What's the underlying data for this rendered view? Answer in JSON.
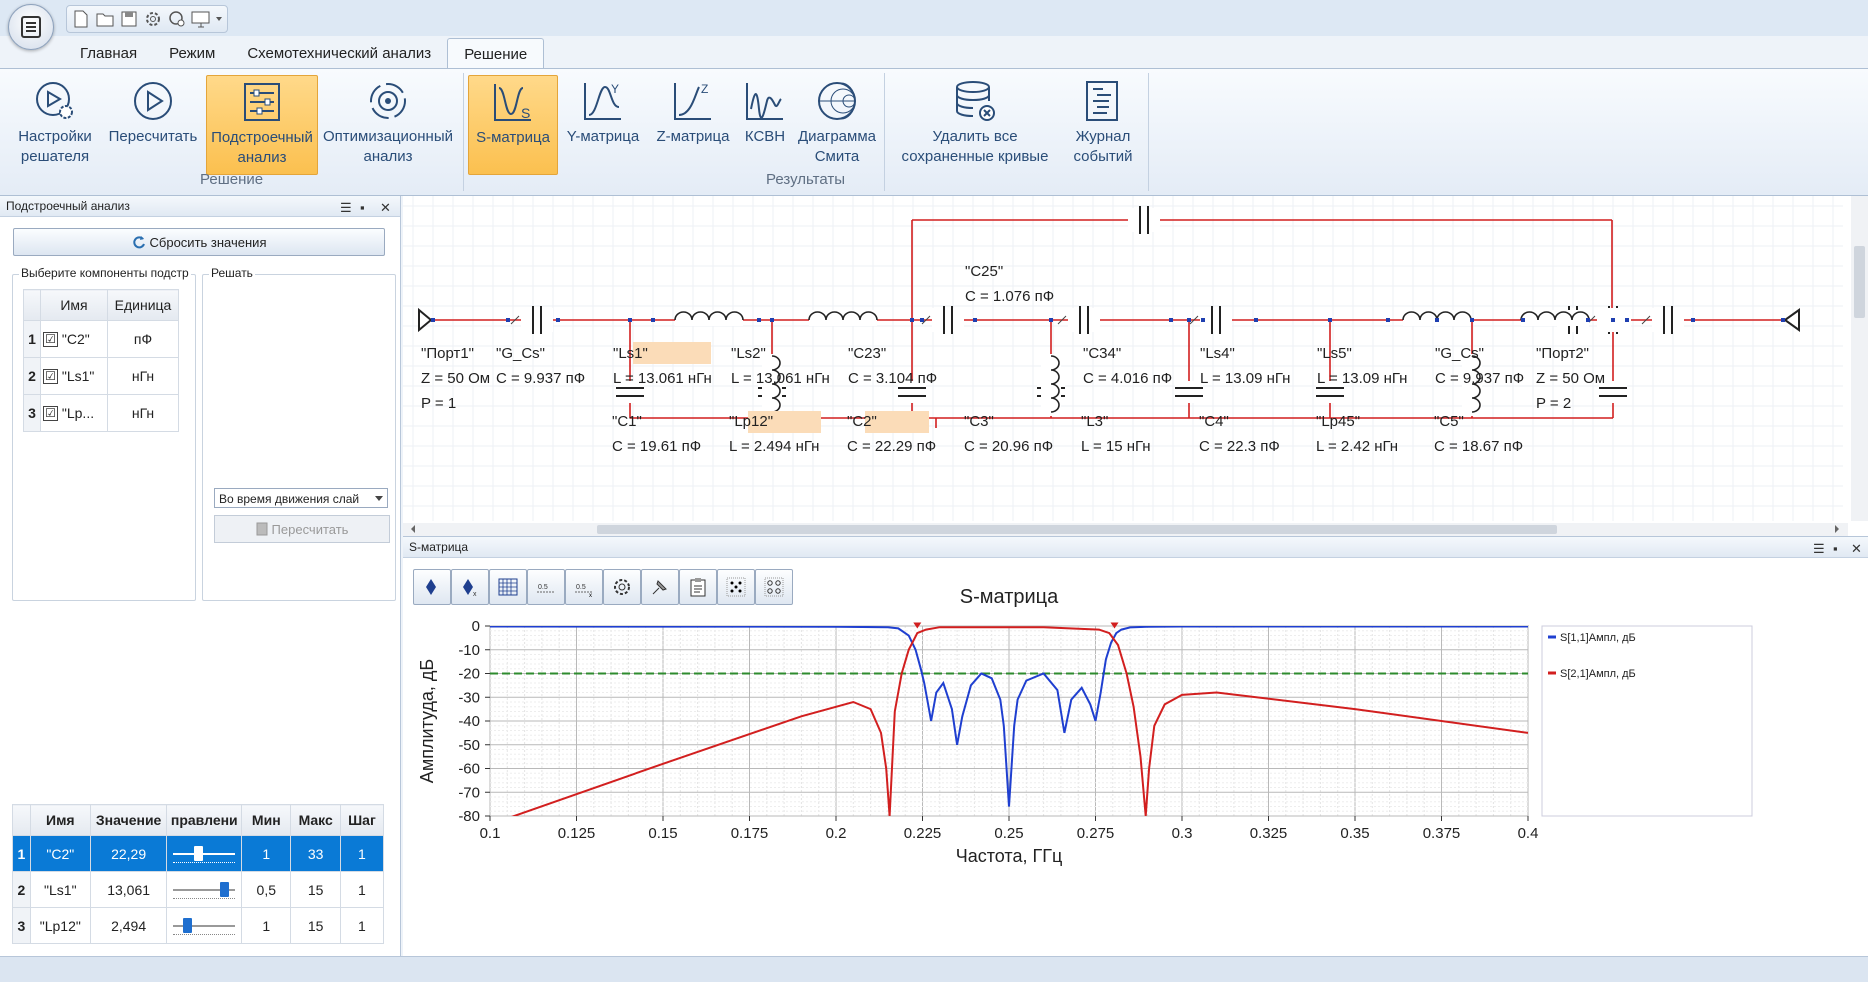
{
  "quick_access": [
    "new-file-icon",
    "open-folder-icon",
    "save-icon",
    "settings-icon",
    "refresh-settings-icon",
    "monitor-icon"
  ],
  "tabs": [
    {
      "label": "Главная",
      "active": false
    },
    {
      "label": "Режим",
      "active": false
    },
    {
      "label": "Схемотехнический анализ",
      "active": false
    },
    {
      "label": "Решение",
      "active": true
    }
  ],
  "ribbon": {
    "solver_settings": [
      "Настройки",
      "решателя"
    ],
    "recalc": "Пересчитать",
    "tuning": [
      "Подстроечный",
      "анализ"
    ],
    "optimization": [
      "Оптимизационный",
      "анализ"
    ],
    "group_solution": "Решение",
    "s_matrix": "S-матрица",
    "y_matrix": "Y-матрица",
    "z_matrix": "Z-матрица",
    "vswr": "КСВН",
    "smith": [
      "Диаграмма",
      "Смита"
    ],
    "delete_curves": [
      "Удалить все",
      "сохраненные кривые"
    ],
    "event_log": [
      "Журнал",
      "событий"
    ],
    "group_results": "Результаты"
  },
  "left_panel": {
    "title": "Подстроечный анализ",
    "reset_label": "Сбросить значения",
    "select_components_label": "Выберите компоненты подстр",
    "solve_label": "Решать",
    "components_headers": [
      "Имя",
      "Единица"
    ],
    "components": [
      {
        "n": "1",
        "name": "\"C2\"",
        "unit": "пФ",
        "checked": "☑"
      },
      {
        "n": "2",
        "name": "\"Ls1\"",
        "unit": "нГн",
        "checked": "☑"
      },
      {
        "n": "3",
        "name": "\"Lp...",
        "unit": "нГн",
        "checked": "☑"
      }
    ],
    "solve_option": "Во время движения слай",
    "recalc_label": "Пересчитать",
    "param_headers": [
      "Имя",
      "Значение",
      "правлени",
      "Мин",
      "Макс",
      "Шаг"
    ],
    "params": [
      {
        "n": "1",
        "name": "\"C2\"",
        "value": "22,29",
        "slider": 0.33,
        "min": "1",
        "max": "33",
        "step": "1"
      },
      {
        "n": "2",
        "name": "\"Ls1\"",
        "value": "13,061",
        "slider": 0.86,
        "min": "0,5",
        "max": "15",
        "step": "1"
      },
      {
        "n": "3",
        "name": "\"Lp12\"",
        "value": "2,494",
        "slider": 0.11,
        "min": "1",
        "max": "15",
        "step": "1"
      }
    ]
  },
  "schematic": {
    "components": [
      {
        "id": "port1",
        "lines": [
          "\"Порт1\"",
          "Z = 50 Ом",
          "P = 1"
        ]
      },
      {
        "id": "g_cs_1",
        "lines": [
          "\"G_Cs\"",
          "C = 9.937 пФ"
        ]
      },
      {
        "id": "ls1",
        "lines": [
          "\"Ls1\"",
          "L = 13.061 нГн"
        ]
      },
      {
        "id": "ls2",
        "lines": [
          "\"Ls2\"",
          "L = 13.061 нГн"
        ]
      },
      {
        "id": "c23",
        "lines": [
          "\"C23\"",
          "C = 3.104 пФ"
        ]
      },
      {
        "id": "c34",
        "lines": [
          "\"C34\"",
          "C = 4.016 пФ"
        ]
      },
      {
        "id": "ls4",
        "lines": [
          "\"Ls4\"",
          "L = 13.09 нГн"
        ]
      },
      {
        "id": "ls5",
        "lines": [
          "\"Ls5\"",
          "L = 13.09 нГн"
        ]
      },
      {
        "id": "g_cs_2",
        "lines": [
          "\"G_Cs\"",
          "C = 9.937 пФ"
        ]
      },
      {
        "id": "port2",
        "lines": [
          "\"Порт2\"",
          "Z = 50 Ом",
          "P = 2"
        ]
      },
      {
        "id": "c1",
        "lines": [
          "\"C1\"",
          "C = 19.61 пФ"
        ]
      },
      {
        "id": "lp12",
        "lines": [
          "\"Lp12\"",
          "L = 2.494 нГн"
        ]
      },
      {
        "id": "c2",
        "lines": [
          "\"C2\"",
          "C = 22.29 пФ"
        ]
      },
      {
        "id": "c3",
        "lines": [
          "\"C3\"",
          "C = 20.96 пФ"
        ]
      },
      {
        "id": "l3",
        "lines": [
          "\"L3\"",
          "L = 15 нГн"
        ]
      },
      {
        "id": "c4",
        "lines": [
          "\"C4\"",
          "C = 22.3 пФ"
        ]
      },
      {
        "id": "lp45",
        "lines": [
          "\"Lp45\"",
          "L = 2.42 нГн"
        ]
      },
      {
        "id": "c5",
        "lines": [
          "\"C5\"",
          "C = 18.67 пФ"
        ]
      },
      {
        "id": "c25",
        "lines": [
          "\"C25\"",
          "C = 1.076 пФ"
        ]
      }
    ],
    "highlight_color": "#fbdcb8",
    "wire_color": "#d21f1f"
  },
  "smatrix_panel": {
    "title": "S-матрица",
    "toolbar": [
      "marker-icon",
      "marker-delete-icon",
      "grid-icon",
      "scale-icon",
      "scale-delete-icon",
      "chart-settings-icon",
      "pin-icon",
      "clipboard-icon",
      "dots-grid-icon",
      "dots-grid-large-icon"
    ]
  },
  "chart_data": {
    "type": "line",
    "title": "S-матрица",
    "xlabel": "Частота, ГГц",
    "ylabel": "Амплитуда, дБ",
    "xlim": [
      0.1,
      0.4
    ],
    "ylim": [
      -80,
      0
    ],
    "xticks": [
      "0.1",
      "0.125",
      "0.15",
      "0.175",
      "0.2",
      "0.225",
      "0.25",
      "0.275",
      "0.3",
      "0.325",
      "0.35",
      "0.375",
      "0.4"
    ],
    "yticks": [
      "0",
      "-10",
      "-20",
      "-30",
      "-40",
      "-50",
      "-60",
      "-70",
      "-80"
    ],
    "grid": true,
    "legend_position": "right",
    "threshold": {
      "y": -20,
      "color": "#2e8b2e"
    },
    "series": [
      {
        "name": "S[1,1]Ампл, дБ",
        "color": "#1f3fd0",
        "x": [
          0.1,
          0.2,
          0.215,
          0.218,
          0.221,
          0.223,
          0.2245,
          0.2255,
          0.2265,
          0.2275,
          0.229,
          0.231,
          0.2335,
          0.235,
          0.2365,
          0.239,
          0.242,
          0.245,
          0.2475,
          0.2485,
          0.25,
          0.2515,
          0.2525,
          0.255,
          0.26,
          0.264,
          0.266,
          0.268,
          0.271,
          0.2735,
          0.275,
          0.2765,
          0.278,
          0.2795,
          0.281,
          0.2825,
          0.285,
          0.29,
          0.3,
          0.4
        ],
        "y": [
          -0.2,
          -0.3,
          -0.5,
          -1,
          -4,
          -10,
          -18,
          -24,
          -32,
          -40,
          -28,
          -24,
          -35,
          -50,
          -38,
          -25,
          -20,
          -22,
          -31,
          -42,
          -76,
          -42,
          -31,
          -23,
          -20,
          -27,
          -45,
          -31,
          -26,
          -33,
          -40,
          -28,
          -14,
          -7,
          -3,
          -1.5,
          -0.6,
          -0.3,
          -0.2,
          -0.2
        ]
      },
      {
        "name": "S[2,1]Ампл, дБ",
        "color": "#d21f1f",
        "x": [
          0.105,
          0.15,
          0.19,
          0.205,
          0.21,
          0.213,
          0.2145,
          0.2155,
          0.217,
          0.219,
          0.221,
          0.2235,
          0.226,
          0.23,
          0.26,
          0.276,
          0.279,
          0.2815,
          0.284,
          0.286,
          0.288,
          0.2895,
          0.2905,
          0.292,
          0.295,
          0.3,
          0.31,
          0.35,
          0.4
        ],
        "y": [
          -81,
          -58,
          -38,
          -32,
          -35,
          -45,
          -60,
          -80,
          -36,
          -20,
          -10,
          -3,
          -1.5,
          -0.5,
          -0.5,
          -1.5,
          -3,
          -8,
          -20,
          -34,
          -55,
          -80,
          -60,
          -42,
          -33,
          -29,
          -28,
          -35,
          -45
        ]
      }
    ]
  }
}
